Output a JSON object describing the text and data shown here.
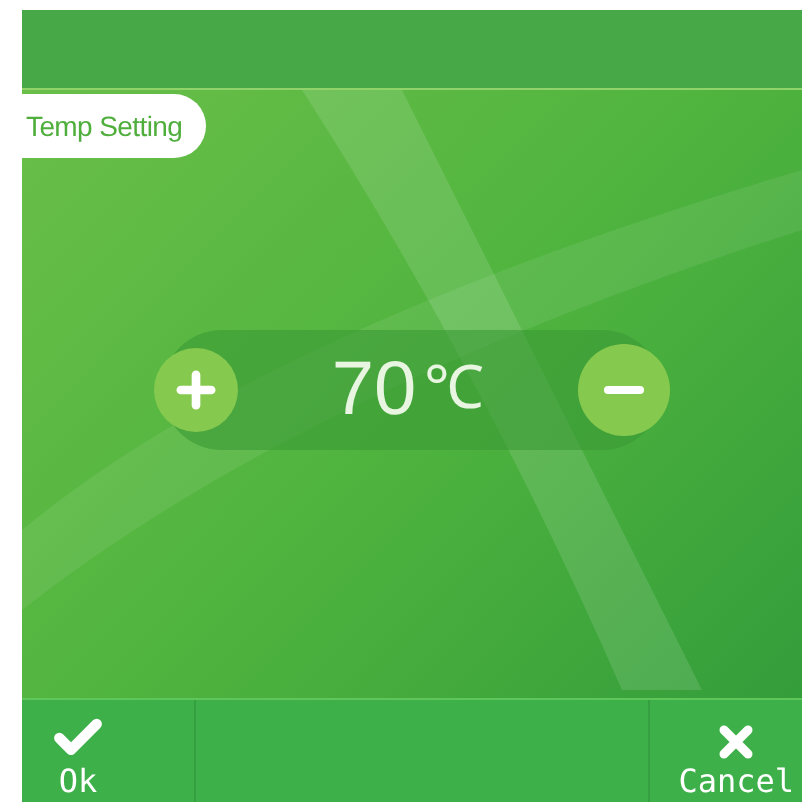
{
  "title_tab": {
    "label": "Temp Setting"
  },
  "temperature": {
    "value": "70",
    "unit": "℃"
  },
  "buttons": [
    {
      "kind": "ok",
      "label": "Ok"
    },
    {
      "kind": "cancel",
      "label": "Cancel"
    }
  ]
}
